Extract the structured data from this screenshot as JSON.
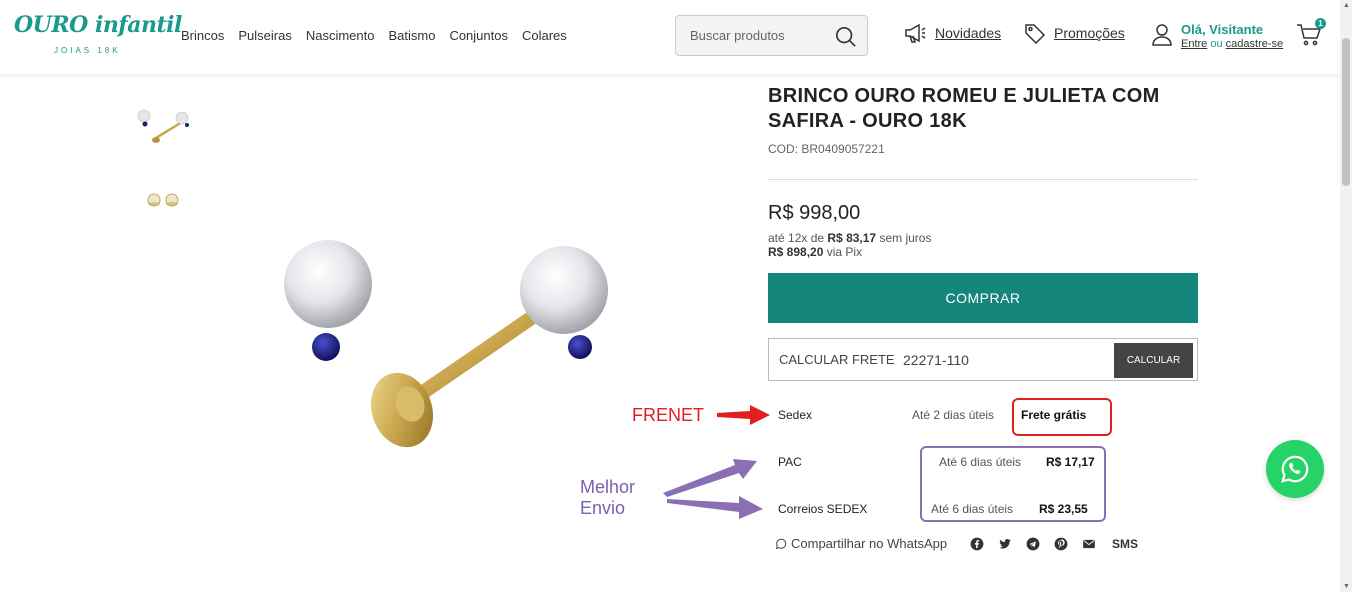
{
  "header": {
    "logo_main": "OURO infantil",
    "logo_sub": "JOIAS 18K",
    "nav": [
      "Brincos",
      "Pulseiras",
      "Nascimento",
      "Batismo",
      "Conjuntos",
      "Colares"
    ],
    "search_placeholder": "Buscar produtos",
    "novidades": "Novidades",
    "promocoes": "Promoções",
    "user_greeting": "Olá, Visitante",
    "user_login": "Entre",
    "user_or": "ou",
    "user_register": "cadastre-se",
    "cart_count": "1"
  },
  "product": {
    "title": "BRINCO OURO ROMEU E JULIETA COM SAFIRA - OURO 18K",
    "code": "COD: BR0409057221",
    "price": "R$ 998,00",
    "installments_prefix": "até 12x de",
    "installments_value": "R$ 83,17",
    "installments_suffix": "sem juros",
    "pix_value": "R$ 898,20",
    "pix_suffix": "via Pix",
    "buy_label": "COMPRAR"
  },
  "shipping": {
    "label": "CALCULAR FRETE",
    "cep": "22271-110",
    "calc_label": "CALCULAR",
    "options": [
      {
        "name": "Sedex",
        "time": "Até 2 dias úteis",
        "price": "Frete grátis"
      },
      {
        "name": "PAC",
        "time": "Até 6 dias úteis",
        "price": "R$ 17,17"
      },
      {
        "name": "Correios SEDEX",
        "time": "Até 6 dias úteis",
        "price": "R$ 23,55"
      }
    ]
  },
  "annotations": {
    "frenet": "FRENET",
    "melhor_envio_1": "Melhor",
    "melhor_envio_2": "Envio",
    "frenet_color": "#e01f1f",
    "melhor_envio_color": "#7b5fb0"
  },
  "share": {
    "whatsapp": "Compartilhar no WhatsApp",
    "sms": "SMS",
    "icons": [
      "facebook-icon",
      "twitter-icon",
      "telegram-icon",
      "pinterest-icon",
      "email-icon"
    ]
  },
  "colors": {
    "brand": "#1a9a8c",
    "buy_button": "#15867b",
    "whatsapp": "#25d366"
  }
}
